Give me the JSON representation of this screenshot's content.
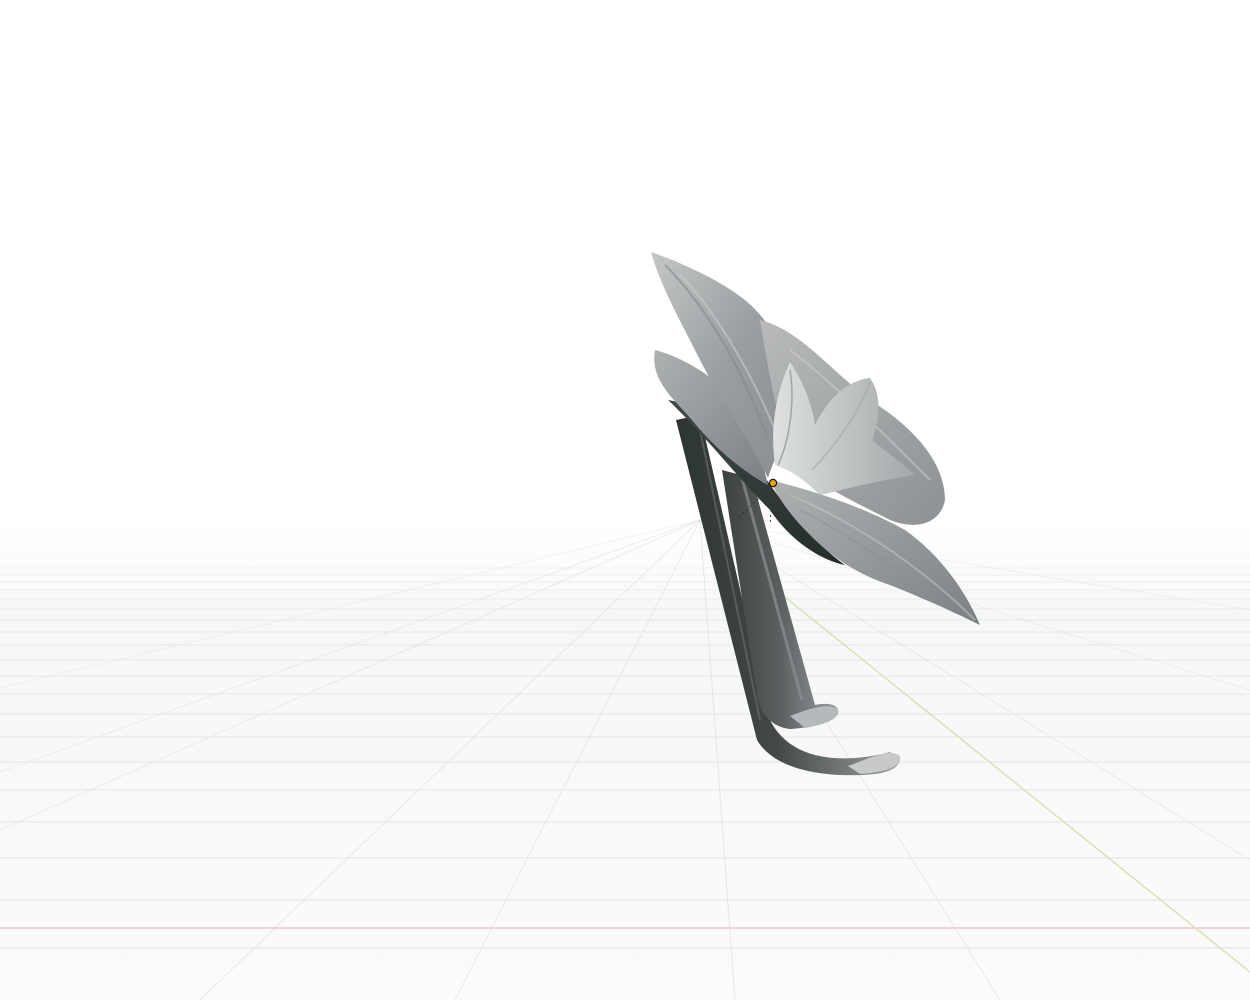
{
  "viewport": {
    "background": "#ffffff",
    "grid_color": "#cfd3d6",
    "horizon_haze": "#eef0f1",
    "x_axis_color": "#e3b3b3",
    "y_axis_color": "#d7dcaf",
    "origin_color": "#f0a500"
  },
  "model": {
    "petal_light": "#d9dbdc",
    "petal_mid": "#a9acae",
    "petal_dark": "#6f7375",
    "stem_dark": "#2c3433",
    "stem_mid": "#5a5f60",
    "stem_light": "#a6a9ab"
  }
}
